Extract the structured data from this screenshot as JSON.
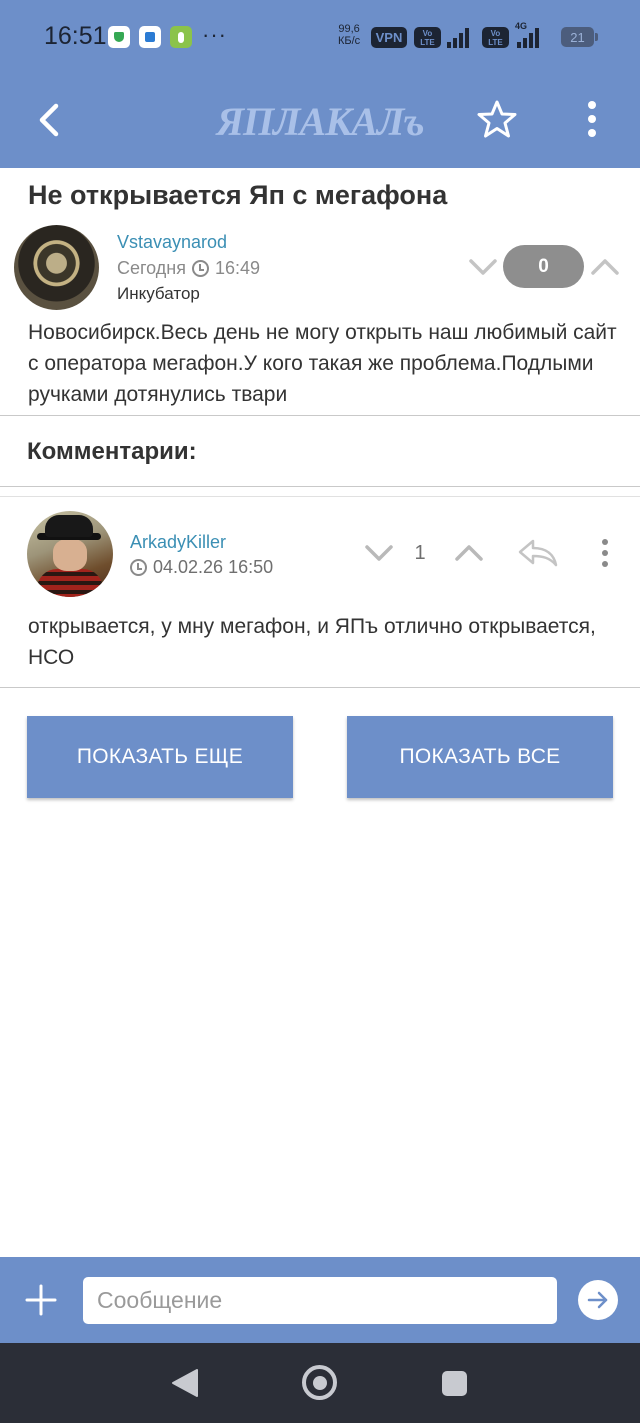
{
  "status_bar": {
    "time": "16:51",
    "more": "···",
    "net_speed_value": "99,6",
    "net_speed_unit": "КБ/с",
    "vpn": "VPN",
    "volte_top": "Vo",
    "volte_bottom": "LTE",
    "network_type": "4G",
    "battery": "21"
  },
  "app_bar": {
    "logo_text": "ЯПЛАКАЛъ",
    "colors": {
      "bar": "#6d8fc9",
      "logo": "#a9c0e8",
      "accent_link": "#3b8fb4"
    }
  },
  "post": {
    "title": "Не открывается Яп с мегафона",
    "author": "Vstavaynarod",
    "date": "Сегодня",
    "time": "16:49",
    "rank": "Инкубатор",
    "score": "0",
    "body": "Новосибирск.Весь день не могу открыть наш любимый сайт с оператора мегафон.У кого такая же проблема.Подлыми ручками дотянулись твари"
  },
  "comments_section": {
    "heading": "Комментарии:",
    "items": [
      {
        "author": "ArkadyKiller",
        "datetime": "04.02.26 16:50",
        "score": "1",
        "body": "открывается, у мну мегафон, и ЯПъ отлично открывается, НСО"
      }
    ]
  },
  "actions": {
    "show_more": "ПОКАЗАТЬ ЕЩЕ",
    "show_all": "ПОКАЗАТЬ ВСЕ"
  },
  "composer": {
    "placeholder": "Сообщение",
    "value": ""
  }
}
